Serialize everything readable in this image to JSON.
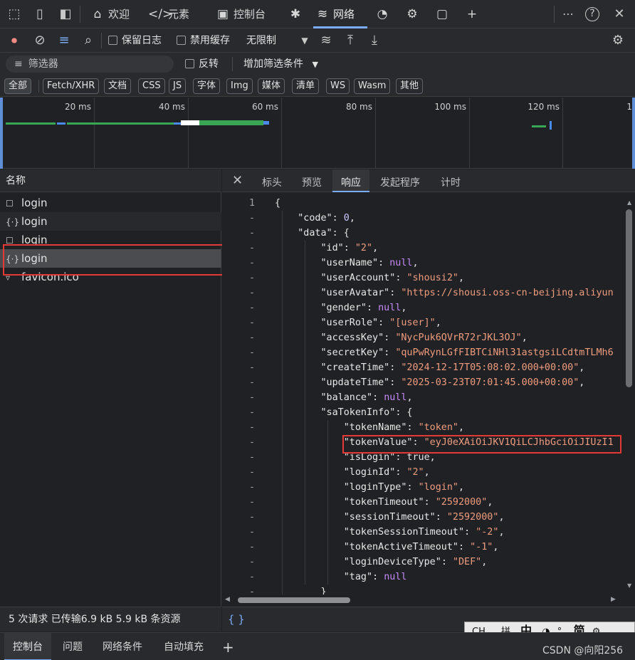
{
  "toolbar": {
    "tabs": [
      {
        "label": "欢迎",
        "icon": "home-icon"
      },
      {
        "label": "元素",
        "icon": "code-icon"
      },
      {
        "label": "控制台",
        "icon": "console-icon"
      },
      {
        "label": "",
        "icon": "bug-icon"
      },
      {
        "label": "网络",
        "icon": "wifi-icon"
      },
      {
        "label": "",
        "icon": "performance-icon"
      },
      {
        "label": "",
        "icon": "cpu-icon"
      },
      {
        "label": "",
        "icon": "application-icon"
      }
    ],
    "more": "⋯",
    "help": "?",
    "close": "✕"
  },
  "network": {
    "preserve_log": "保留日志",
    "disable_cache": "禁用缓存",
    "throttle": "无限制"
  },
  "filter": {
    "placeholder": "筛选器",
    "invert": "反转",
    "add_filter": "增加筛选条件"
  },
  "types": [
    "全部",
    "Fetch/XHR",
    "文档",
    "CSS",
    "JS",
    "字体",
    "Img",
    "媒体",
    "清单",
    "WS",
    "Wasm",
    "其他"
  ],
  "timeline": {
    "ticks": [
      "20 ms",
      "40 ms",
      "60 ms",
      "80 ms",
      "100 ms",
      "120 ms",
      "1"
    ]
  },
  "requests": {
    "header": "名称",
    "items": [
      {
        "name": "login",
        "type": "doc"
      },
      {
        "name": "login",
        "type": "fetch"
      },
      {
        "name": "login",
        "type": "doc"
      },
      {
        "name": "login",
        "type": "fetch"
      },
      {
        "name": "favicon.ico",
        "type": "img"
      }
    ]
  },
  "detail": {
    "tabs": [
      "标头",
      "预览",
      "响应",
      "发起程序",
      "计时"
    ],
    "active_tab": "响应"
  },
  "code_lines": [
    {
      "g": "1",
      "t": "{"
    },
    {
      "g": "-",
      "t": "    \"code\": 0,"
    },
    {
      "g": "-",
      "t": "    \"data\": {"
    },
    {
      "g": "-",
      "t": "        \"id\": \"2\","
    },
    {
      "g": "-",
      "t": "        \"userName\": null,"
    },
    {
      "g": "-",
      "t": "        \"userAccount\": \"shousi2\","
    },
    {
      "g": "-",
      "t": "        \"userAvatar\": \"https://shousi.oss-cn-beijing.aliyun"
    },
    {
      "g": "-",
      "t": "        \"gender\": null,"
    },
    {
      "g": "-",
      "t": "        \"userRole\": \"[user]\","
    },
    {
      "g": "-",
      "t": "        \"accessKey\": \"NycPuk6QVrR72rJKL3OJ\","
    },
    {
      "g": "-",
      "t": "        \"secretKey\": \"quPwRynLGfFIBTCiNHl31astgsiLCdtmTLMh6"
    },
    {
      "g": "-",
      "t": "        \"createTime\": \"2024-12-17T05:08:02.000+00:00\","
    },
    {
      "g": "-",
      "t": "        \"updateTime\": \"2025-03-23T07:01:45.000+00:00\","
    },
    {
      "g": "-",
      "t": "        \"balance\": null,"
    },
    {
      "g": "-",
      "t": "        \"saTokenInfo\": {"
    },
    {
      "g": "-",
      "t": "            \"tokenName\": \"token\","
    },
    {
      "g": "-",
      "t": "            \"tokenValue\": \"eyJ0eXAiOiJKV1QiLCJhbGciOiJIUzI1"
    },
    {
      "g": "-",
      "t": "            \"isLogin\": true,"
    },
    {
      "g": "-",
      "t": "            \"loginId\": \"2\","
    },
    {
      "g": "-",
      "t": "            \"loginType\": \"login\","
    },
    {
      "g": "-",
      "t": "            \"tokenTimeout\": \"2592000\","
    },
    {
      "g": "-",
      "t": "            \"sessionTimeout\": \"2592000\","
    },
    {
      "g": "-",
      "t": "            \"tokenSessionTimeout\": \"-2\","
    },
    {
      "g": "-",
      "t": "            \"tokenActiveTimeout\": \"-1\","
    },
    {
      "g": "-",
      "t": "            \"loginDeviceType\": \"DEF\","
    },
    {
      "g": "-",
      "t": "            \"tag\": null"
    },
    {
      "g": "-",
      "t": "        }"
    }
  ],
  "status": {
    "summary": "5 次请求  已传输6.9 kB  5.9 kB 条资源",
    "format_button": "{ }"
  },
  "drawer": {
    "tabs": [
      "控制台",
      "问题",
      "网络条件",
      "自动填充"
    ],
    "add": "+"
  },
  "ime": {
    "items": [
      "CH",
      "拼",
      "中",
      "简"
    ]
  },
  "watermark": "CSDN @向阳256"
}
